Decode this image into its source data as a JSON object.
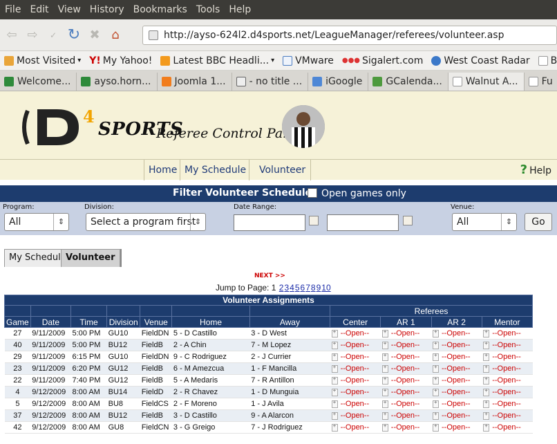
{
  "menu": [
    "File",
    "Edit",
    "View",
    "History",
    "Bookmarks",
    "Tools",
    "Help"
  ],
  "address": "http://ayso-624l2.d4sports.net/LeagueManager/referees/volunteer.asp",
  "bookmarks": [
    "Most Visited",
    "My Yahoo!",
    "Latest BBC Headli...",
    "VMware",
    "Sigalert.com",
    "West Coast Radar",
    "Backu"
  ],
  "tabs": [
    "Welcome...",
    "ayso.horn...",
    "Joomla 1...",
    "- no title ...",
    "iGoogle",
    "GCalenda...",
    "Walnut A...",
    "Fu"
  ],
  "logo": {
    "four": "4",
    "sports": "SPORTS",
    "panel": "Referee Control Panel"
  },
  "nav": {
    "home": "Home",
    "my_schedule": "My Schedule",
    "volunteer": "Volunteer",
    "help": "Help"
  },
  "filter": {
    "title": "Filter Volunteer Schedule",
    "open_only_label": "Open games only",
    "labels": {
      "program": "Program:",
      "division": "Division:",
      "date_range": "Date Range:",
      "venue": "Venue:"
    },
    "program_value": "All",
    "division_value": "Select a program first",
    "venue_value": "All",
    "go_label": "Go"
  },
  "page_tabs": {
    "my_schedule": "My Schedule",
    "volunteer": "Volunteer"
  },
  "next_label": "NEXT >>",
  "jump_label": "Jump to Page:",
  "jump_pages": [
    "1",
    "2",
    "3",
    "4",
    "5",
    "6",
    "7",
    "8",
    "9",
    "10"
  ],
  "table": {
    "title": "Volunteer Assignments",
    "referees_header": "Referees",
    "columns": [
      "Game",
      "Date",
      "Time",
      "Division",
      "Venue",
      "Home",
      "Away",
      "Center",
      "AR 1",
      "AR 2",
      "Mentor"
    ],
    "open_text": "--Open--",
    "rows": [
      {
        "game": "27",
        "date": "9/11/2009",
        "time": "5:00 PM",
        "division": "GU10",
        "venue": "FieldDN",
        "home": "5 - D Castillo",
        "away": "3 - D West"
      },
      {
        "game": "40",
        "date": "9/11/2009",
        "time": "5:00 PM",
        "division": "BU12",
        "venue": "FieldB",
        "home": "2 - A Chin",
        "away": "7 - M Lopez"
      },
      {
        "game": "29",
        "date": "9/11/2009",
        "time": "6:15 PM",
        "division": "GU10",
        "venue": "FieldDN",
        "home": "9 - C Rodriguez",
        "away": "2 - J Currier"
      },
      {
        "game": "23",
        "date": "9/11/2009",
        "time": "6:20 PM",
        "division": "GU12",
        "venue": "FieldB",
        "home": "6 - M Amezcua",
        "away": "1 - F Mancilla"
      },
      {
        "game": "22",
        "date": "9/11/2009",
        "time": "7:40 PM",
        "division": "GU12",
        "venue": "FieldB",
        "home": "5 - A Medaris",
        "away": "7 - R Antillon"
      },
      {
        "game": "4",
        "date": "9/12/2009",
        "time": "8:00 AM",
        "division": "BU14",
        "venue": "FieldD",
        "home": "2 - R Chavez",
        "away": "1 - D Munguia"
      },
      {
        "game": "5",
        "date": "9/12/2009",
        "time": "8:00 AM",
        "division": "BU8",
        "venue": "FieldCS",
        "home": "2 - F Moreno",
        "away": "1 - J Avila"
      },
      {
        "game": "37",
        "date": "9/12/2009",
        "time": "8:00 AM",
        "division": "BU12",
        "venue": "FieldB",
        "home": "3 - D Castillo",
        "away": "9 - A Alarcon"
      },
      {
        "game": "42",
        "date": "9/12/2009",
        "time": "8:00 AM",
        "division": "GU8",
        "venue": "FieldCN",
        "home": "3 - G Greigo",
        "away": "7 - J Rodriguez"
      }
    ]
  }
}
